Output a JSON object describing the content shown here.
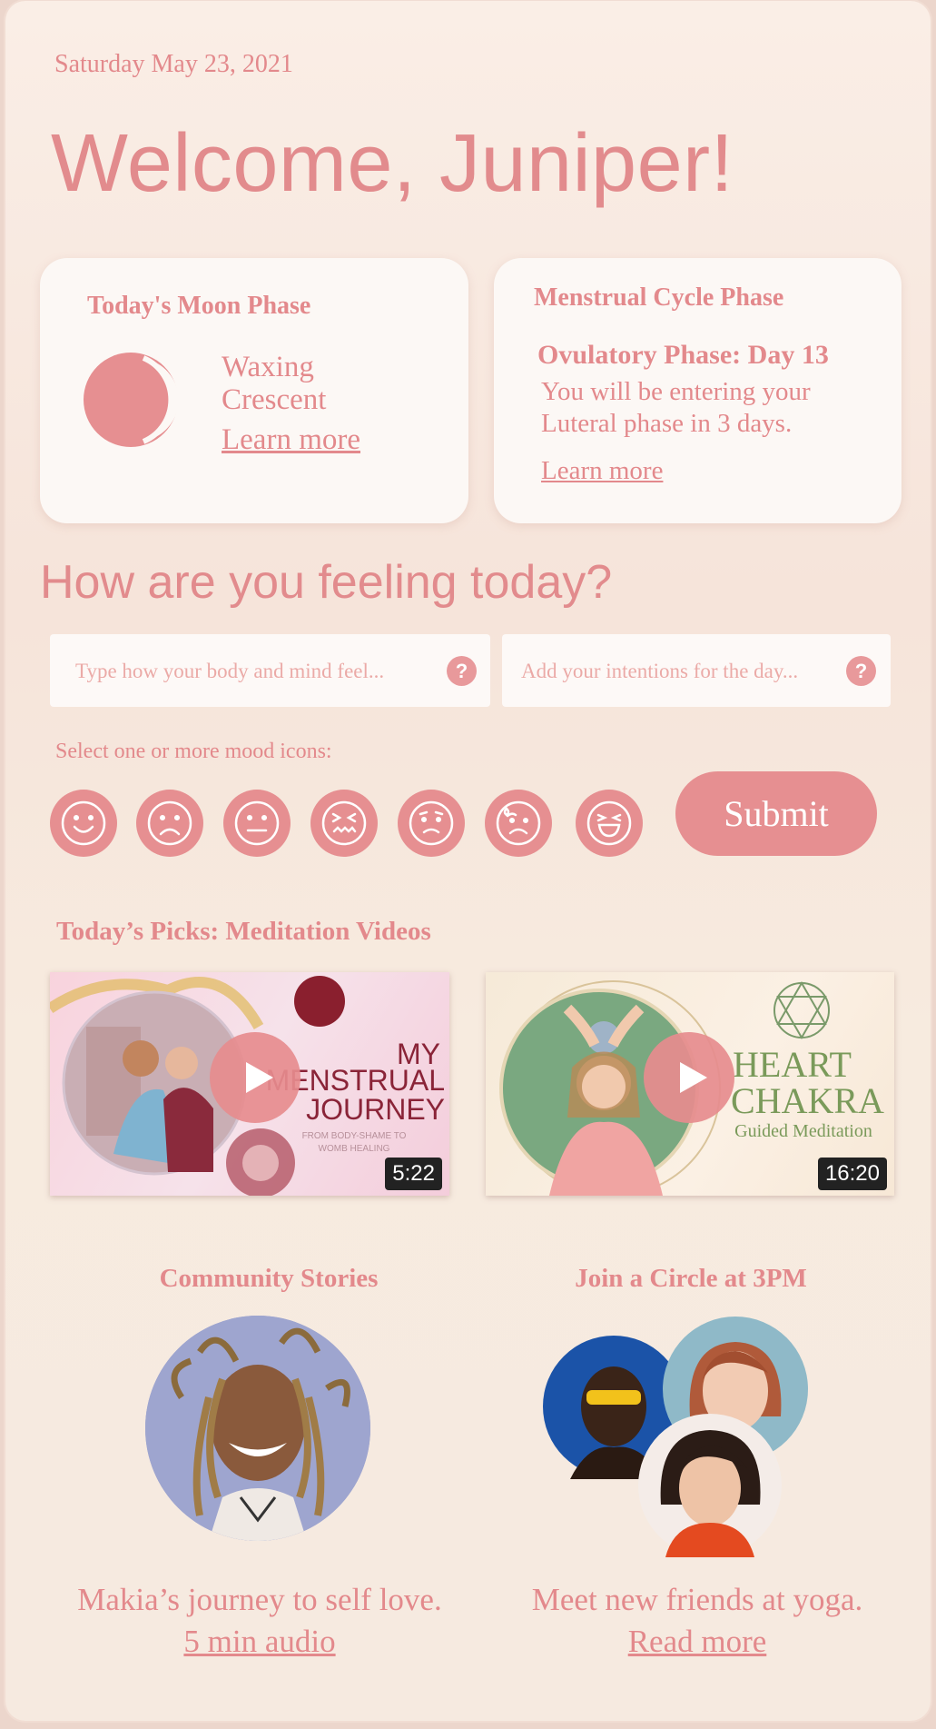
{
  "header": {
    "date": "Saturday May 23, 2021",
    "welcome": "Welcome, Juniper!"
  },
  "moon_card": {
    "title": "Today's Moon Phase",
    "phase_line1": "Waxing",
    "phase_line2": "Crescent",
    "learn_more": "Learn more"
  },
  "cycle_card": {
    "title": "Menstrual Cycle Phase",
    "phase": "Ovulatory Phase: Day 13",
    "description": "You will be entering  your Luteral phase in 3 days.",
    "learn_more": "Learn more"
  },
  "feeling": {
    "heading": "How are you feeling today?",
    "body_placeholder": "Type how your body and mind feel...",
    "intentions_placeholder": "Add your intentions for the day...",
    "help_glyph": "?",
    "mood_label": "Select one or more mood icons:",
    "moods": [
      "happy",
      "sad",
      "neutral",
      "overwhelmed",
      "uneasy",
      "anxious",
      "joyful"
    ],
    "submit": "Submit"
  },
  "picks": {
    "title": "Today’s Picks: Meditation Videos",
    "videos": [
      {
        "title_lines": [
          "MY",
          "MENSTRUAL",
          "JOURNEY"
        ],
        "subtitle_lines": [
          "FROM BODY-SHAME TO",
          "WOMB HEALING"
        ],
        "duration": "5:22"
      },
      {
        "title_lines": [
          "HEART",
          "CHAKRA"
        ],
        "subtitle_lines": [
          "Guided Meditation"
        ],
        "duration": "16:20"
      }
    ]
  },
  "community": {
    "title": "Community Stories",
    "caption": "Makia’s journey to self love.",
    "link": "5 min audio"
  },
  "circle": {
    "title": "Join a Circle at 3PM",
    "caption": "Meet new friends at yoga.",
    "link": "Read more"
  },
  "colors": {
    "accent": "#e68f91",
    "text": "#e3898c",
    "card": "#fcf8f5",
    "background": "#f6e6dc"
  }
}
